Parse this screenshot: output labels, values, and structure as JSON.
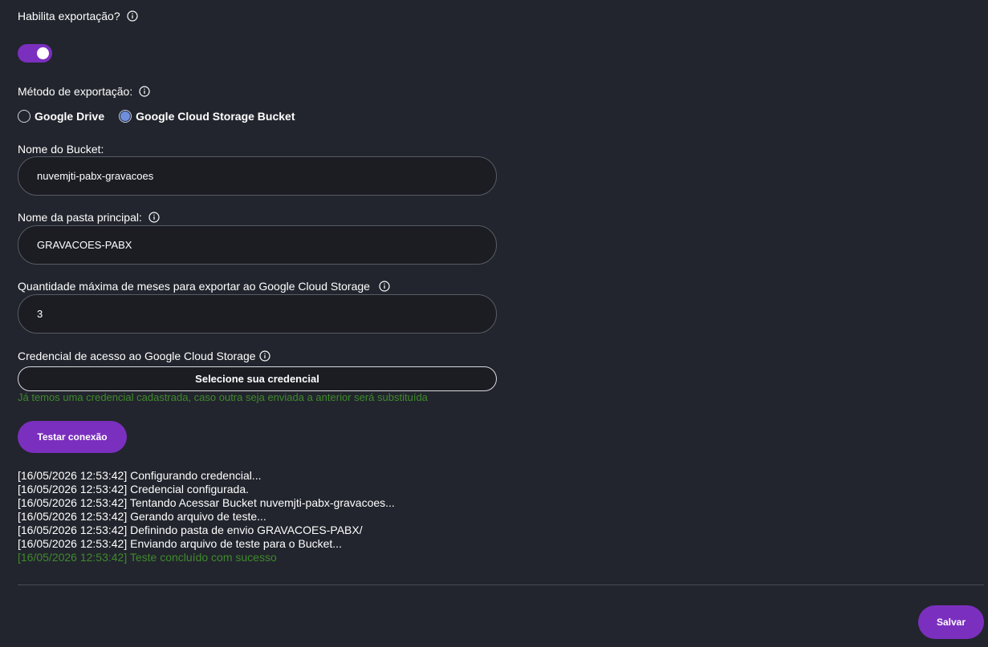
{
  "export": {
    "label": "Habilita exportação?",
    "enabled": true
  },
  "method": {
    "label": "Método de exportação:",
    "options": [
      "Google Drive",
      "Google Cloud Storage Bucket"
    ],
    "selected": "Google Cloud Storage Bucket"
  },
  "bucket": {
    "label": "Nome do Bucket:",
    "value": "nuvemjti-pabx-gravacoes"
  },
  "folder": {
    "label": "Nome da pasta principal:",
    "value": "GRAVACOES-PABX"
  },
  "months": {
    "label": "Quantidade máxima de meses para exportar ao Google Cloud Storage",
    "value": "3"
  },
  "credential": {
    "label": "Credencial de acesso ao Google Cloud Storage",
    "button_label": "Selecione sua credencial",
    "hint": "Já temos uma credencial cadastrada, caso outra seja enviada a anterior será substituída"
  },
  "test_button": "Testar conexão",
  "log": [
    {
      "text": "[16/05/2026 12:53:42] Configurando credencial...",
      "status": "info"
    },
    {
      "text": "[16/05/2026 12:53:42] Credencial configurada.",
      "status": "info"
    },
    {
      "text": "[16/05/2026 12:53:42] Tentando Acessar Bucket nuvemjti-pabx-gravacoes...",
      "status": "info"
    },
    {
      "text": "[16/05/2026 12:53:42] Gerando arquivo de teste...",
      "status": "info"
    },
    {
      "text": "[16/05/2026 12:53:42] Definindo pasta de envio GRAVACOES-PABX/",
      "status": "info"
    },
    {
      "text": "[16/05/2026 12:53:42] Enviando arquivo de teste para o Bucket...",
      "status": "info"
    },
    {
      "text": "[16/05/2026 12:53:42] Teste concluído com sucesso",
      "status": "success"
    }
  ],
  "save_button": "Salvar",
  "colors": {
    "accent": "#7b2fbe",
    "success": "#3f8a2c",
    "background": "#22252d",
    "radio_selected": "#6f8fdc"
  },
  "icons": {
    "info": "info-circle-icon"
  }
}
